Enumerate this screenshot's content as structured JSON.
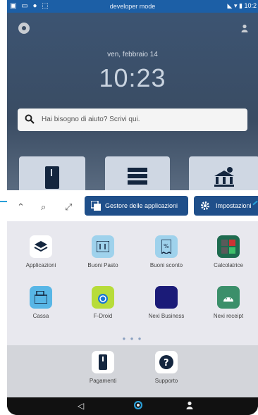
{
  "status_bar": {
    "center_text": "developer mode",
    "time": "10:2"
  },
  "lock": {
    "date": "ven, febbraio 14",
    "time": "10:23"
  },
  "search": {
    "placeholder": "Hai bisogno di aiuto? Scrivi qui."
  },
  "action_bar": {
    "manager_label": "Gestore delle applicazioni",
    "settings_label": "Impostazioni"
  },
  "apps": [
    {
      "label": "Applicazioni",
      "color": "#ffffff"
    },
    {
      "label": "Buoni Pasto",
      "color": "#9fd2ec"
    },
    {
      "label": "Buoni sconto",
      "color": "#9fd2ec"
    },
    {
      "label": "Calcolatrice",
      "color": "#1e6b4f"
    },
    {
      "label": "Cassa",
      "color": "#58b6e6"
    },
    {
      "label": "F-Droid",
      "color": "#b7dc3a"
    },
    {
      "label": "Nexi Business",
      "color": "#1b1b78"
    },
    {
      "label": "Nexi receipt",
      "color": "#3b8f6a"
    }
  ],
  "dock": [
    {
      "label": "Pagamenti"
    },
    {
      "label": "Supporto"
    }
  ],
  "colors": {
    "accent": "#1f4f8a",
    "status_bar": "#1c5fa6"
  }
}
